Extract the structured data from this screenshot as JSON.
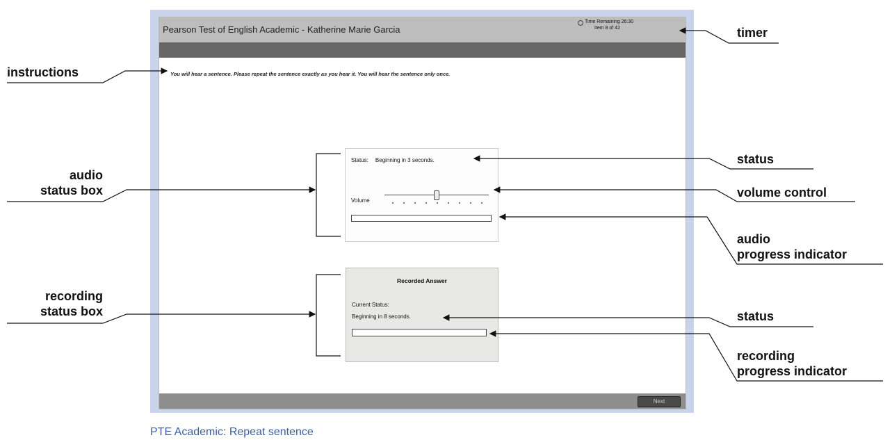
{
  "window": {
    "title": "Pearson Test of English Academic - Katherine Marie Garcia",
    "timer_label": "Time Remaining 26:30",
    "item_label": "Item 8 of 42"
  },
  "instructions": "You will hear a sentence. Please repeat the sentence exactly as you hear it. You will hear the sentence only once.",
  "audio_box": {
    "status_label": "Status:",
    "status_value": "Beginning in 3 seconds.",
    "volume_label": "Volume"
  },
  "recording_box": {
    "title": "Recorded Answer",
    "current_status_label": "Current Status:",
    "status_value": "Beginning in 8 seconds."
  },
  "footer": {
    "next_label": "Next"
  },
  "caption": "PTE Academic: Repeat sentence",
  "annotations": {
    "timer": "timer",
    "instructions": "instructions",
    "audio_status_box_line1": "audio",
    "audio_status_box_line2": "status box",
    "status_audio": "status",
    "volume_control": "volume control",
    "audio_progress_line1": "audio",
    "audio_progress_line2": "progress indicator",
    "recording_status_box_line1": "recording",
    "recording_status_box_line2": "status box",
    "status_recording": "status",
    "recording_progress_line1": "recording",
    "recording_progress_line2": "progress indicator"
  }
}
